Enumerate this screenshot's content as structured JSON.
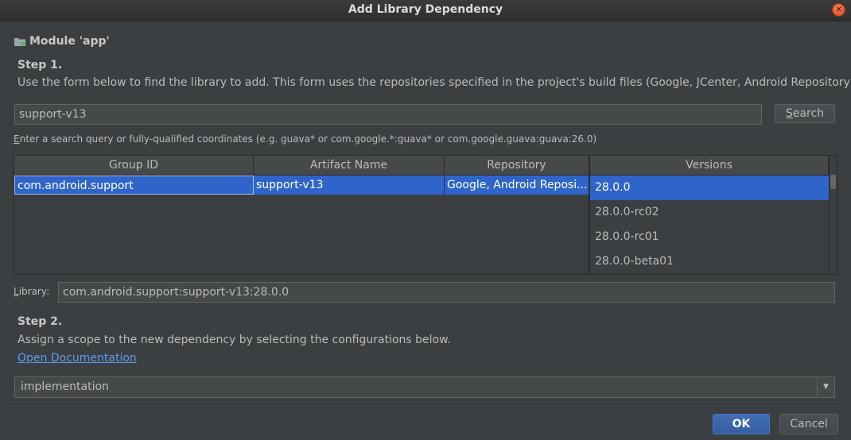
{
  "window": {
    "title": "Add Library Dependency"
  },
  "module": {
    "label": "Module 'app'"
  },
  "step1": {
    "title": "Step 1.",
    "description": "Use the form below to find the library to add. This form uses the repositories specified in the project's build files (Google, JCenter, Android Repository)"
  },
  "search": {
    "value": "support-v13",
    "button_label_underlined": "S",
    "button_label_rest": "earch",
    "hint_underlined": "E",
    "hint_rest": "nter a search query or fully-qualified coordinates (e.g. guava* or com.google.*:guava* or com.google.guava:guava:26.0)"
  },
  "results": {
    "columns": [
      "Group ID",
      "Artifact Name",
      "Repository"
    ],
    "rows": [
      {
        "group_id": "com.android.support",
        "artifact": "support-v13",
        "repository": "Google, Android Reposi..."
      }
    ]
  },
  "versions": {
    "header": "Versions",
    "items": [
      "28.0.0",
      "28.0.0-rc02",
      "28.0.0-rc01",
      "28.0.0-beta01"
    ]
  },
  "library": {
    "label_underlined": "L",
    "label_rest": "ibrary:",
    "value": "com.android.support:support-v13:28.0.0"
  },
  "step2": {
    "title": "Step 2.",
    "description": "Assign a scope to the new dependency by selecting the configurations below.",
    "doc_link": "Open Documentation",
    "scope_value": "implementation"
  },
  "buttons": {
    "ok": "OK",
    "cancel": "Cancel"
  },
  "colors": {
    "selection": "#2f65ca",
    "link": "#589df6",
    "background": "#3c3f41"
  }
}
